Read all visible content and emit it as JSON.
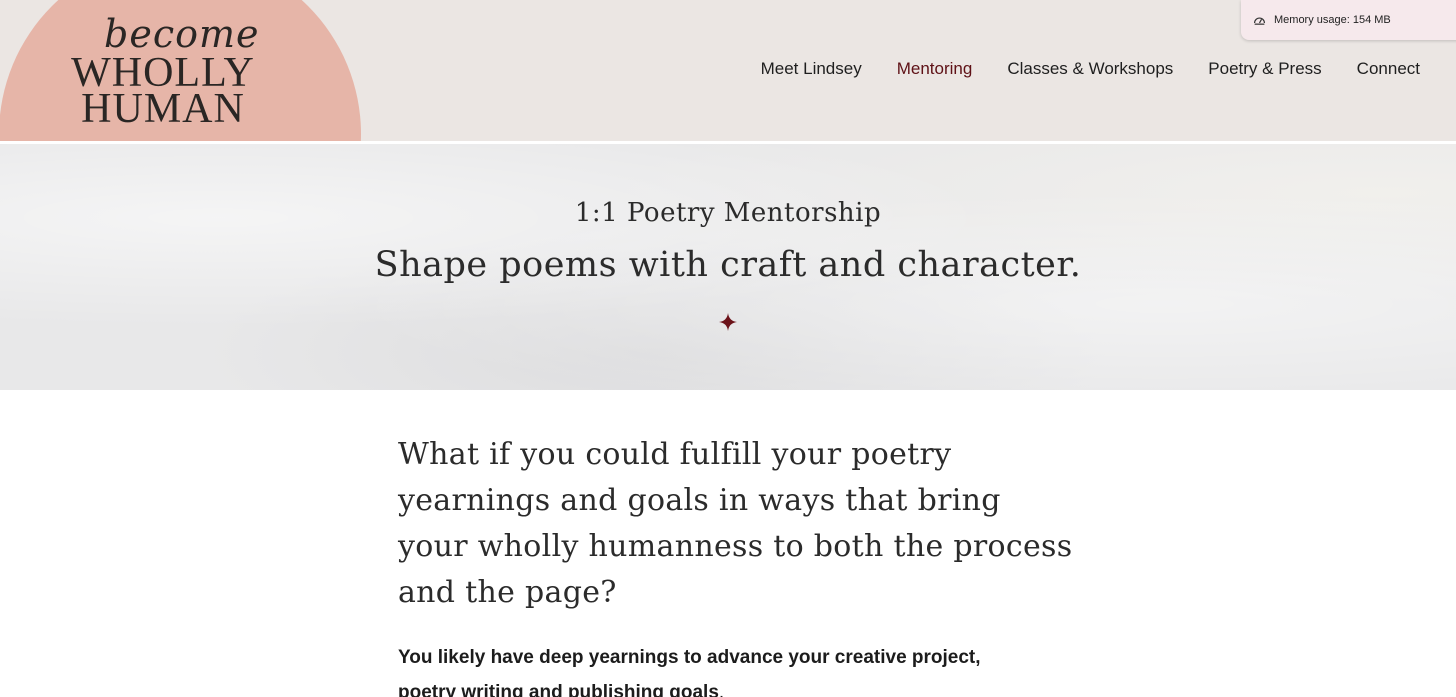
{
  "memory": {
    "label": "Memory usage: 154 MB",
    "icon": "gauge-icon"
  },
  "logo": {
    "script": "become",
    "line1": "WHOLLY",
    "line2": "HUMAN",
    "color": "#e6b5a8"
  },
  "nav": {
    "items": [
      {
        "label": "Meet Lindsey"
      },
      {
        "label": "Mentoring"
      },
      {
        "label": "Classes & Workshops"
      },
      {
        "label": "Poetry & Press"
      },
      {
        "label": "Connect"
      }
    ],
    "active": "Mentoring",
    "active_color": "#5e1116"
  },
  "hero": {
    "subtitle": "1:1 Poetry Mentorship",
    "title": "Shape poems with craft and character.",
    "ornament": "four-point-star-icon",
    "ornament_color": "#6b1219"
  },
  "content": {
    "lead": "What if you could fulfill your poetry yearnings and goals in ways that bring your wholly humanness to both the process and the page?",
    "paragraph_bold": "You likely have deep yearnings to advance your creative project, poetry writing and publishing goals",
    "paragraph_end": "."
  }
}
